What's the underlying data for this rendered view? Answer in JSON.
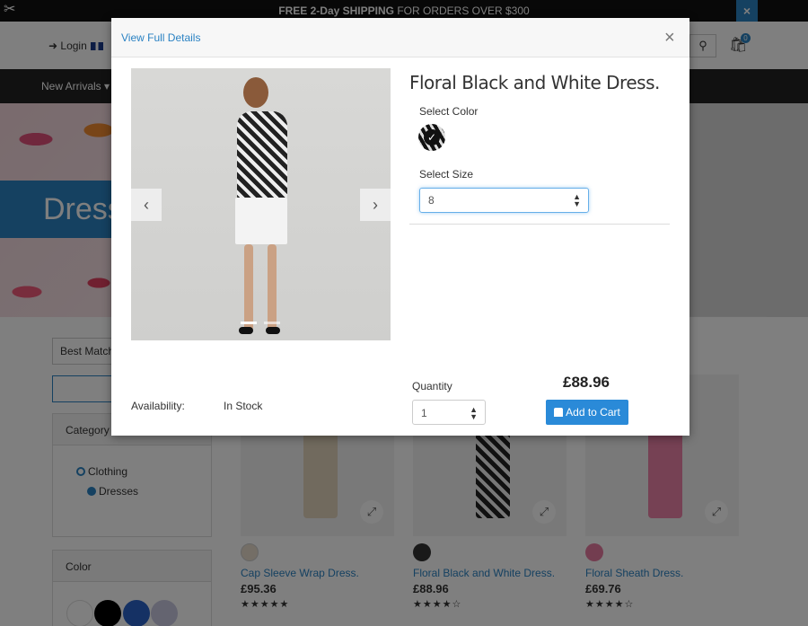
{
  "topbar": {
    "tools_icon": "tools-icon",
    "promo_bold": "FREE 2-Day SHIPPING",
    "promo_rest": " FOR ORDERS OVER $300",
    "close_glyph": "×"
  },
  "header": {
    "login": "Login",
    "search_glyph": "⚲",
    "cart_count": "0"
  },
  "nav": {
    "first_item": "New Arrivals ▾"
  },
  "hero": {
    "title": "Dresses"
  },
  "sidebar": {
    "sort_value": "Best Match",
    "category_heading": "Category",
    "categories": [
      "Clothing",
      "Dresses"
    ],
    "color_heading": "Color",
    "swatch_colors": [
      "#ffffff",
      "#000000",
      "#2b63c8",
      "#c8c8e0"
    ]
  },
  "products": [
    {
      "name": "Cap Sleeve Wrap Dress.",
      "price": "£95.36",
      "stars": "★★★★★",
      "color": "#e8dccc",
      "dress": "#e3d4bd"
    },
    {
      "name": "Floral Black and White Dress.",
      "price": "£88.96",
      "stars": "★★★★☆",
      "color": "#333333",
      "dress": "#f0f0f0"
    },
    {
      "name": "Floral Sheath Dress.",
      "price": "£69.76",
      "stars": "★★★★☆",
      "color": "#e77ba0",
      "dress": "#ec82a8"
    }
  ],
  "modal": {
    "view_full": "View Full Details",
    "close_glyph": "×",
    "prev_glyph": "‹",
    "next_glyph": "›",
    "title": "Floral Black and White Dress.",
    "select_color_label": "Select Color",
    "select_size_label": "Select Size",
    "size_value": "8",
    "availability_label": "Availability:",
    "availability_value": "In Stock",
    "quantity_label": "Quantity",
    "quantity_value": "1",
    "price": "£88.96",
    "add_to_cart": "Add to Cart",
    "check_glyph": "✓"
  },
  "colors": {
    "accent": "#2a82c3",
    "button": "#2a8ad8"
  }
}
